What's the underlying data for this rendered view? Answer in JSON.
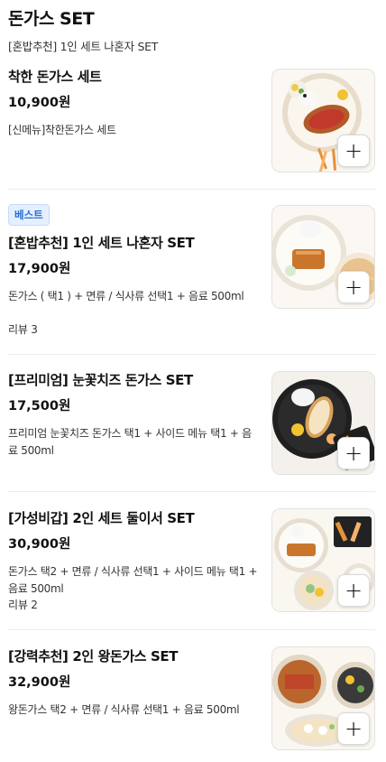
{
  "category": {
    "title": "돈가스 SET",
    "subtitle": "[혼밥추천] 1인 세트 나혼자 SET"
  },
  "items": [
    {
      "badge": "",
      "name": "착한 돈가스 세트",
      "price": "10,900원",
      "description": "[신메뉴]착한돈가스 세트",
      "review": "",
      "add_icon": "plus-icon"
    },
    {
      "badge": "베스트",
      "name": "[혼밥추천] 1인 세트 나혼자 SET",
      "price": "17,900원",
      "description": "돈가스 ( 택1 ) + 면류 / 식사류 선택1 + 음료 500ml",
      "review": "리뷰 3",
      "add_icon": "plus-icon"
    },
    {
      "badge": "",
      "name": "[프리미엄] 눈꽃치즈 돈가스 SET",
      "price": "17,500원",
      "description": "프리미엄 눈꽃치즈 돈가스 택1 + 사이드 메뉴 택1 + 음료 500ml",
      "review": "",
      "add_icon": "plus-icon"
    },
    {
      "badge": "",
      "name": "[가성비갑] 2인 세트 둘이서 SET",
      "price": "30,900원",
      "description": "돈가스 택2 + 면류 / 식사류 선택1 + 사이드 메뉴 택1 + 음료 500ml",
      "review": "리뷰 2",
      "add_icon": "plus-icon"
    },
    {
      "badge": "",
      "name": "[강력추천] 2인 왕돈가스 SET",
      "price": "32,900원",
      "description": "왕돈가스 택2 + 면류 / 식사류 선택1 + 음료 500ml",
      "review": "",
      "add_icon": "plus-icon"
    }
  ],
  "add_label": "+"
}
